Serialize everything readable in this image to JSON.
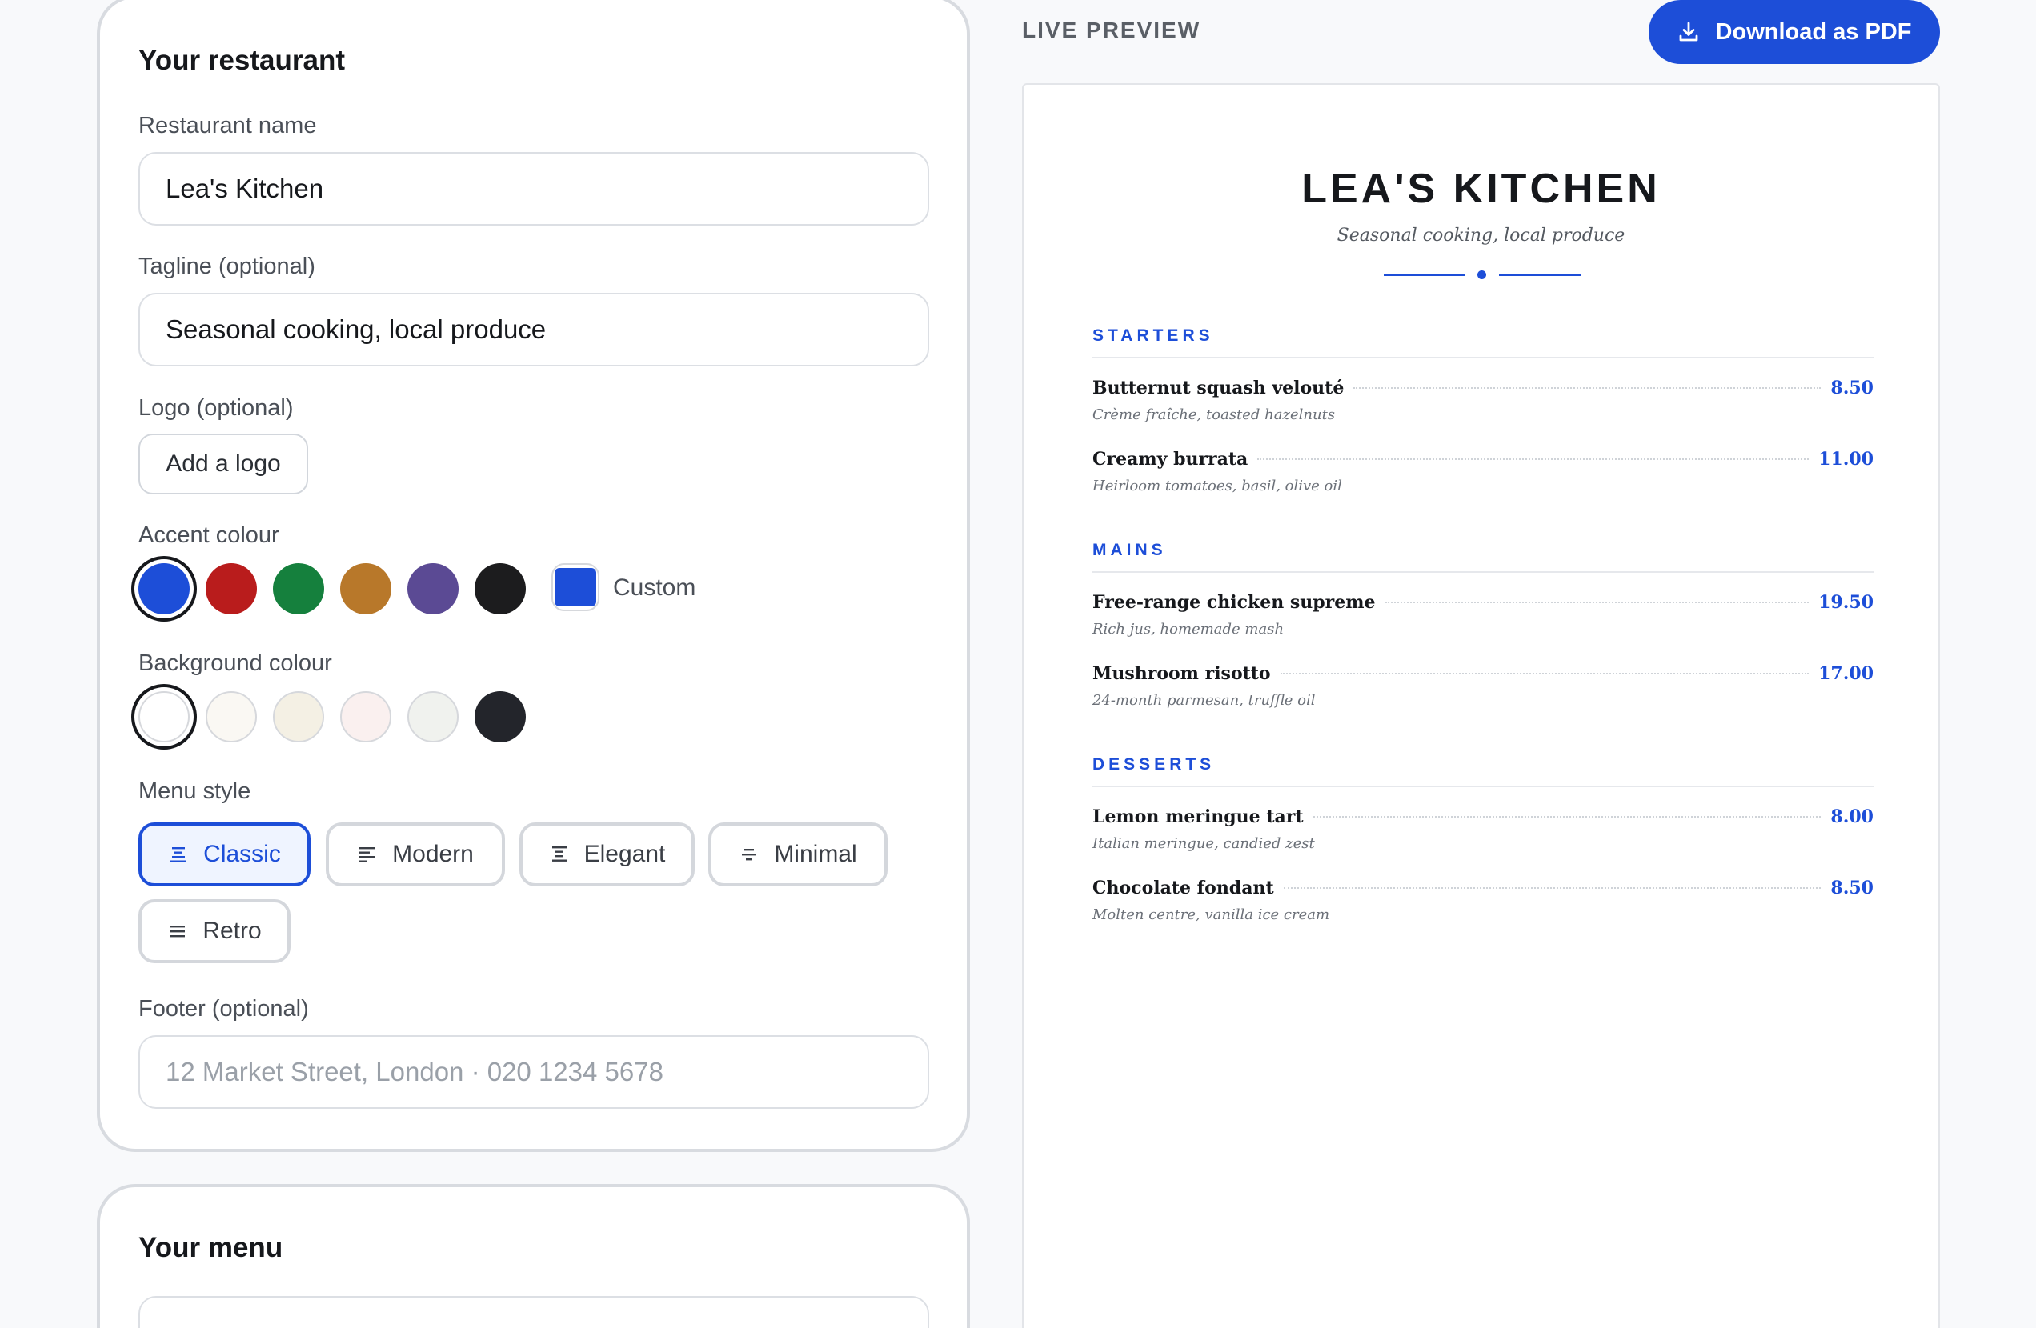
{
  "restaurant_card": {
    "title": "Your restaurant",
    "name_label": "Restaurant name",
    "name_value": "Lea's Kitchen",
    "tagline_label": "Tagline (optional)",
    "tagline_value": "Seasonal cooking, local produce",
    "logo_label": "Logo (optional)",
    "logo_button": "Add a logo",
    "accent_label": "Accent colour",
    "accent_colors": [
      "#1d4ed8",
      "#b91c1c",
      "#15803d",
      "#b8782a",
      "#5b4a94",
      "#1c1c1e"
    ],
    "accent_selected": "#1d4ed8",
    "custom_label": "Custom",
    "custom_color": "#1d4ed8",
    "background_label": "Background colour",
    "background_colors": [
      "#ffffff",
      "#faf8f3",
      "#f4f0e4",
      "#faf0ef",
      "#f0f2ee",
      "#23252b"
    ],
    "background_selected": "#ffffff",
    "style_label": "Menu style",
    "styles": [
      "Classic",
      "Modern",
      "Elegant",
      "Minimal",
      "Retro"
    ],
    "style_selected": "Classic",
    "footer_label": "Footer (optional)",
    "footer_placeholder": "12 Market Street, London · 020 1234 5678"
  },
  "menu_card": {
    "title": "Your menu"
  },
  "preview": {
    "label": "LIVE PREVIEW",
    "download_label": "Download as PDF",
    "restaurant_name": "LEA'S KITCHEN",
    "tagline": "Seasonal cooking, local produce",
    "accent": "#1d4ed8",
    "sections": [
      {
        "title": "STARTERS",
        "items": [
          {
            "name": "Butternut squash velouté",
            "price": "8.50",
            "desc": "Crème fraîche, toasted hazelnuts"
          },
          {
            "name": "Creamy burrata",
            "price": "11.00",
            "desc": "Heirloom tomatoes, basil, olive oil"
          }
        ]
      },
      {
        "title": "MAINS",
        "items": [
          {
            "name": "Free-range chicken supreme",
            "price": "19.50",
            "desc": "Rich jus, homemade mash"
          },
          {
            "name": "Mushroom risotto",
            "price": "17.00",
            "desc": "24-month parmesan, truffle oil"
          }
        ]
      },
      {
        "title": "DESSERTS",
        "items": [
          {
            "name": "Lemon meringue tart",
            "price": "8.00",
            "desc": "Italian meringue, candied zest"
          },
          {
            "name": "Chocolate fondant",
            "price": "8.50",
            "desc": "Molten centre, vanilla ice cream"
          }
        ]
      }
    ]
  }
}
